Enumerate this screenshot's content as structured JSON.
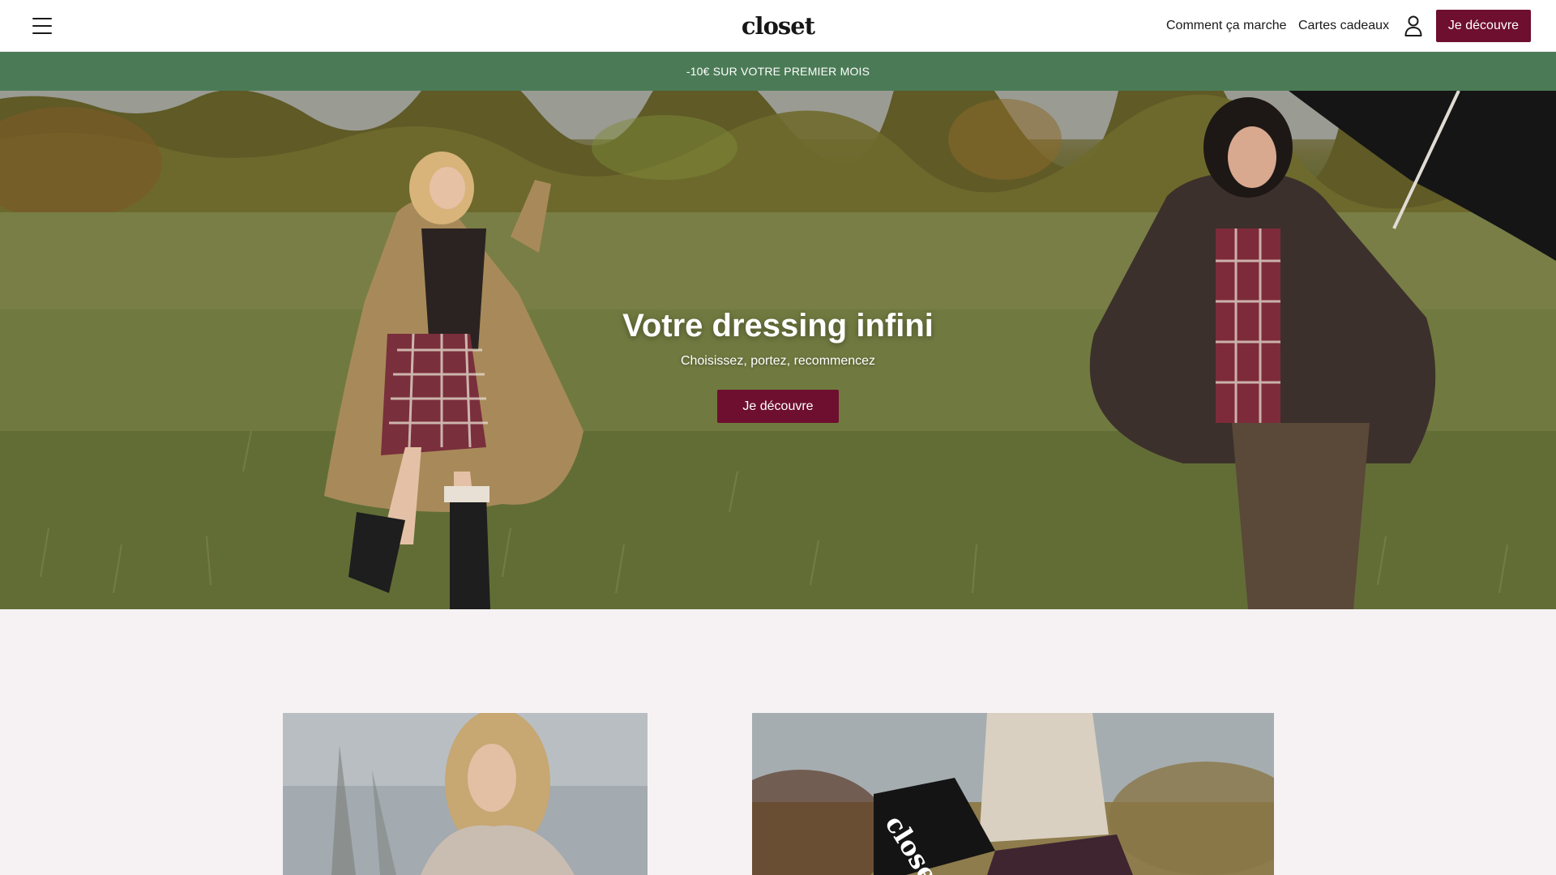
{
  "header": {
    "logo_text": "closet",
    "nav": {
      "how_it_works": "Comment ça marche",
      "gift_cards": "Cartes cadeaux"
    },
    "cta_label": "Je découvre",
    "icons": {
      "menu": "hamburger-menu-icon",
      "account": "user-icon"
    }
  },
  "promo": {
    "text": "-10€ SUR VOTRE PREMIER MOIS"
  },
  "hero": {
    "title": "Votre dressing infini",
    "subtitle": "Choisissez, portez, recommencez",
    "cta_label": "Je découvre"
  },
  "features": {
    "right_bag_text": "closet"
  },
  "colors": {
    "accent": "#6e0f2f",
    "promo_bg": "#4b7b56",
    "page_bg": "#f6f2f3"
  }
}
